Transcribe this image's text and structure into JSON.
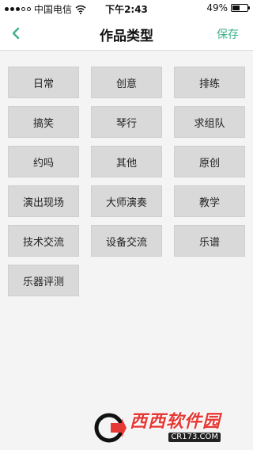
{
  "status_bar": {
    "carrier": "中国电信",
    "time": "下午2:43",
    "battery_percent": "49%",
    "battery_level": 0.49,
    "wifi_icon": "wifi-icon",
    "signal_dots_filled": 3
  },
  "nav": {
    "title": "作品类型",
    "save_label": "保存",
    "back_icon": "chevron-left-icon",
    "accent_color": "#3fb08c"
  },
  "tags": [
    {
      "label": "日常"
    },
    {
      "label": "创意"
    },
    {
      "label": "排练"
    },
    {
      "label": "搞笑"
    },
    {
      "label": "琴行"
    },
    {
      "label": "求组队"
    },
    {
      "label": "约吗"
    },
    {
      "label": "其他"
    },
    {
      "label": "原创"
    },
    {
      "label": "演出现场"
    },
    {
      "label": "大师演奏"
    },
    {
      "label": "教学"
    },
    {
      "label": "技术交流"
    },
    {
      "label": "设备交流"
    },
    {
      "label": "乐谱"
    },
    {
      "label": "乐器评测"
    }
  ],
  "watermark": {
    "main": "西西软件园",
    "sub": "CR173.COM"
  }
}
